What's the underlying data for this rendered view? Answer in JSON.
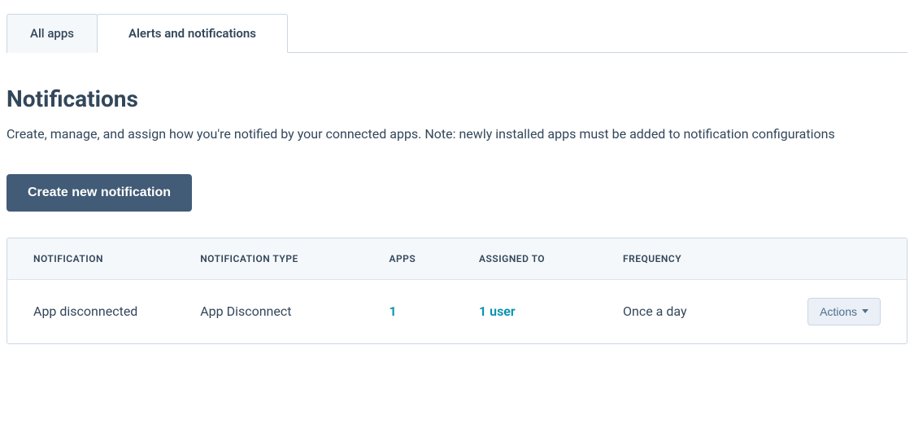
{
  "tabs": [
    {
      "label": "All apps",
      "active": false
    },
    {
      "label": "Alerts and notifications",
      "active": true
    }
  ],
  "page": {
    "title": "Notifications",
    "description": "Create, manage, and assign how you're notified by your connected apps. Note: newly installed apps must be added to notification configurations"
  },
  "buttons": {
    "create": "Create new notification",
    "actions": "Actions"
  },
  "table": {
    "headers": {
      "notification": "NOTIFICATION",
      "type": "NOTIFICATION TYPE",
      "apps": "APPS",
      "assigned": "ASSIGNED TO",
      "frequency": "FREQUENCY"
    },
    "rows": [
      {
        "notification": "App disconnected",
        "type": "App Disconnect",
        "apps": "1",
        "assigned": "1 user",
        "frequency": "Once a day"
      }
    ]
  }
}
